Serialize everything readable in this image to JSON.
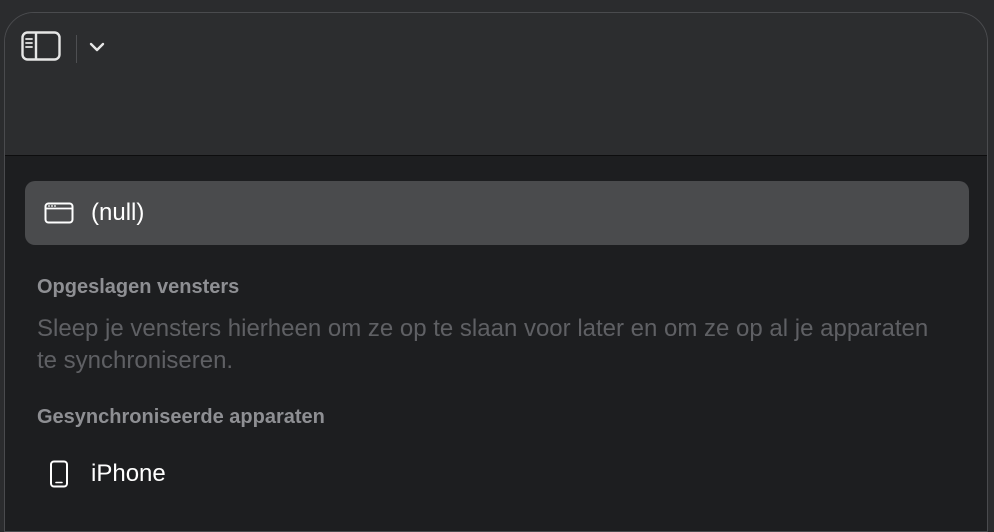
{
  "toolbar": {
    "sidebar_icon": "sidebar-icon",
    "chevron_icon": "chevron-down-icon"
  },
  "current_window": {
    "icon": "window-icon",
    "label": "(null)"
  },
  "saved_windows": {
    "title": "Opgeslagen vensters",
    "hint": "Sleep je vensters hierheen om ze op te slaan voor later en om ze op al je apparaten te synchroniseren."
  },
  "synced_devices": {
    "title": "Gesynchroniseerde apparaten",
    "devices": [
      {
        "icon": "iphone-icon",
        "label": "iPhone"
      }
    ]
  },
  "colors": {
    "titlebar": "#2c2d2f",
    "panel": "#1d1e20",
    "selected_row": "#4a4b4d",
    "section_title": "#8e8f93",
    "hint_text": "#5f6064"
  }
}
